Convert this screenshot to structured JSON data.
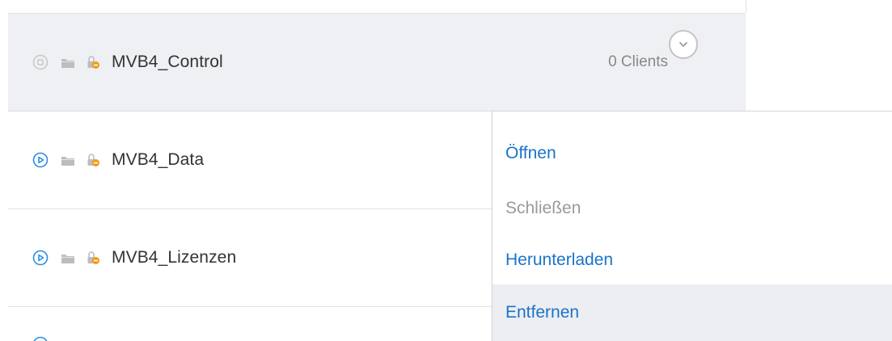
{
  "databases": [
    {
      "name": "MVB4_Control",
      "state": "stopped",
      "clients": "0 Clients",
      "selected": true
    },
    {
      "name": "MVB4_Data",
      "state": "running"
    },
    {
      "name": "MVB4_Lizenzen",
      "state": "running"
    },
    {
      "name": "",
      "state": "running"
    }
  ],
  "menu": {
    "items": [
      {
        "label": "Öffnen",
        "enabled": true
      },
      {
        "label": "Schließen",
        "enabled": false
      },
      {
        "label": "Herunterladen",
        "enabled": true
      },
      {
        "label": "Entfernen",
        "enabled": true,
        "hovered": true
      }
    ]
  },
  "icons": {
    "stopped_state": "stop-circle-icon",
    "running_state": "play-circle-icon",
    "folder": "folder-icon",
    "lock": "lock-minus-icon",
    "toggle": "chevron-down-circle-icon"
  },
  "colors": {
    "link": "#1b73c8",
    "disabled": "#9a9a9a",
    "selected_row": "#eef0f4",
    "hover_item": "#eceef2",
    "lock_badge": "#f39c12",
    "play_icon": "#2b8ee5"
  }
}
